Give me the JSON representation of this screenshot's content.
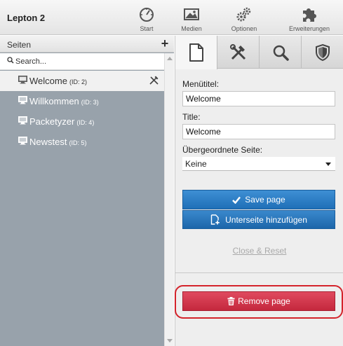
{
  "app": {
    "title": "Lepton 2"
  },
  "toolbar": {
    "start": {
      "label": "Start",
      "icon": "speedometer-icon"
    },
    "media": {
      "label": "Medien",
      "icon": "image-icon"
    },
    "options": {
      "label": "Optionen",
      "icon": "gears-icon"
    },
    "extensions": {
      "label": "Erweiterungen",
      "icon": "puzzle-icon"
    }
  },
  "sidebar": {
    "title": "Seiten",
    "add_label": "+",
    "search_placeholder": "Search...",
    "pages": [
      {
        "name": "Welcome",
        "id_label": "(ID: 2)",
        "selected": true
      },
      {
        "name": "Willkommen",
        "id_label": "(ID: 3)",
        "selected": false
      },
      {
        "name": "Packetyzer",
        "id_label": "(ID: 4)",
        "selected": false
      },
      {
        "name": "Newstest",
        "id_label": "(ID: 5)",
        "selected": false
      }
    ]
  },
  "tabs": [
    {
      "name": "page",
      "icon": "document-icon",
      "active": true
    },
    {
      "name": "tools",
      "icon": "tools-icon",
      "active": false
    },
    {
      "name": "search",
      "icon": "search-icon",
      "active": false
    },
    {
      "name": "security",
      "icon": "shield-icon",
      "active": false
    }
  ],
  "form": {
    "menu_title_label": "Menütitel:",
    "menu_title_value": "Welcome",
    "title_label": "Title:",
    "title_value": "Welcome",
    "parent_label": "Übergeordnete Seite:",
    "parent_value": "Keine"
  },
  "actions": {
    "save_label": "Save page",
    "add_subpage_label": "Unterseite hinzufügen",
    "close_reset_label": "Close & Reset",
    "remove_label": "Remove page"
  },
  "colors": {
    "primary": "#2a7cc4",
    "danger": "#d33a50",
    "highlight": "#d4232b",
    "sidebar": "#98a2ab"
  }
}
